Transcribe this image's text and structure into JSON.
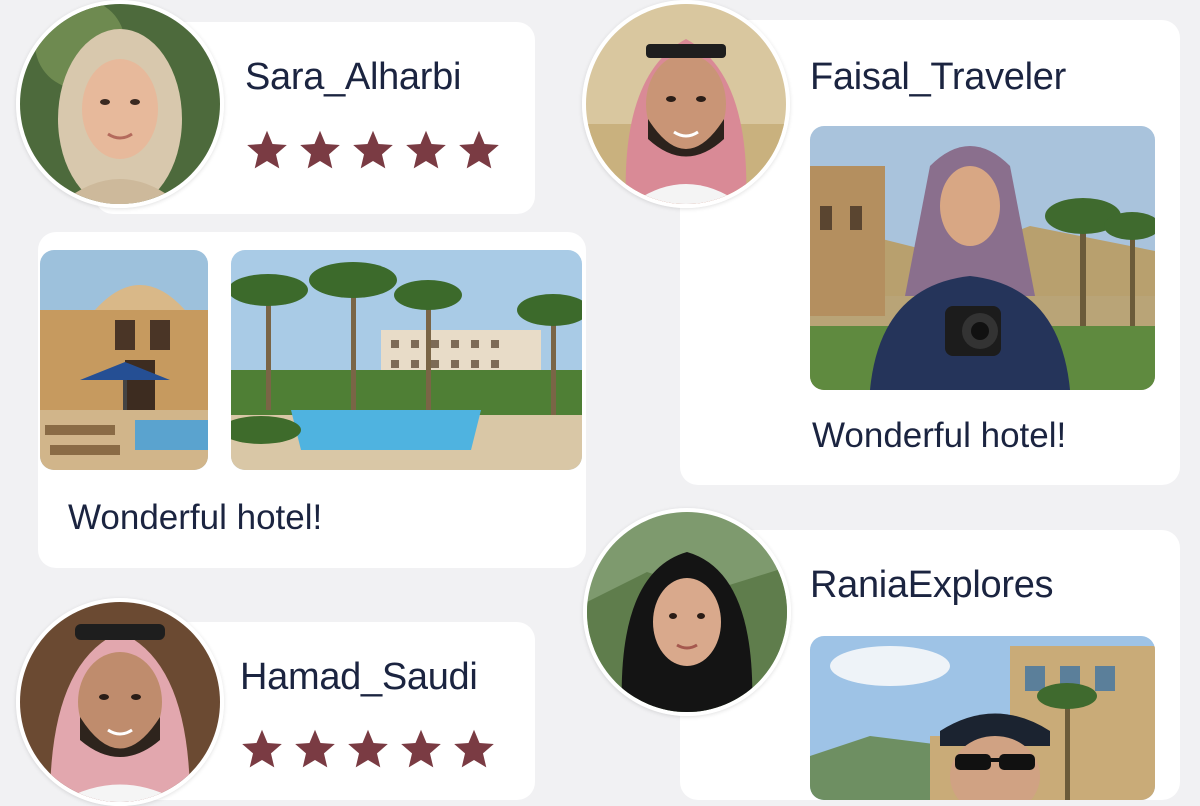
{
  "colors": {
    "star": "#7a3b43",
    "text": "#1b2440",
    "card": "#ffffff",
    "background": "#f1f1f3"
  },
  "reviews": [
    {
      "username": "Sara_Alharbi",
      "rating": 5,
      "avatar_icon": "woman-hijab-avatar"
    },
    {
      "username": "Faisal_Traveler",
      "text": "Wonderful hotel!",
      "avatar_icon": "man-shemagh-avatar",
      "photo": "woman-with-camera-photo"
    },
    {
      "text": "Wonderful hotel!",
      "photos": [
        "hotel-building-photo",
        "hotel-pool-palms-photo"
      ]
    },
    {
      "username": "RaniaExplores",
      "avatar_icon": "woman-black-hijab-avatar",
      "photo": "man-sunglasses-hotel-photo"
    },
    {
      "username": "Hamad_Saudi",
      "rating": 5,
      "avatar_icon": "man-shemagh-avatar"
    }
  ]
}
